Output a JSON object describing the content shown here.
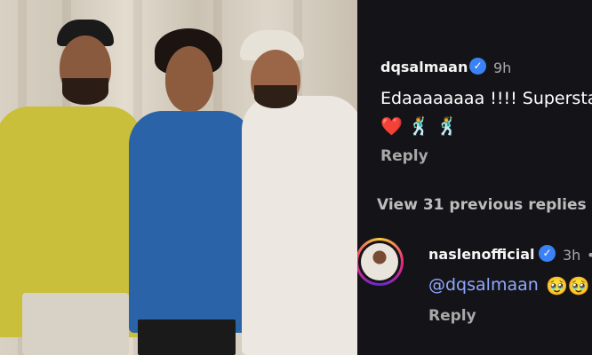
{
  "comments": [
    {
      "username": "dqsalmaan",
      "time": "9h",
      "text": "Edaaaaaaaa !!!! Supersta",
      "emojis": "❤️ 🕺 🕺",
      "reply_label": "Reply"
    }
  ],
  "view_replies_label": "View 31 previous replies",
  "reply_comment": {
    "username": "naslenofficial",
    "time": "3h",
    "more": "•",
    "mention": "@dqsalmaan",
    "emojis": "🥹🥹",
    "reply_label": "Reply"
  },
  "icons": {
    "verified": "verified-badge-icon"
  },
  "colors": {
    "panel_bg": "#141418",
    "verified": "#3b82f6",
    "mention": "#8fa8ff",
    "muted": "#a8a8a8"
  }
}
